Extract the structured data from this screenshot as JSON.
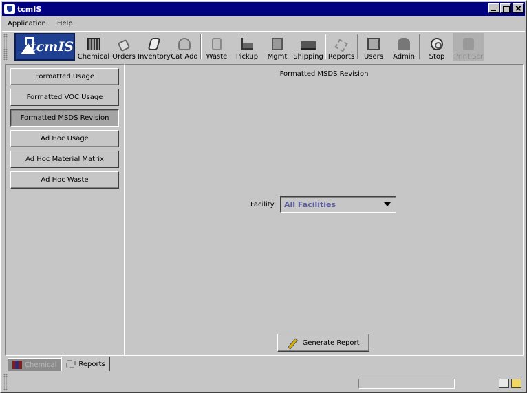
{
  "window": {
    "title": "tcmIS"
  },
  "menu": [
    "Application",
    "Help"
  ],
  "logo": {
    "text": "tcmIS"
  },
  "toolbar": [
    {
      "label": "Chemical",
      "icon": "chemical-icon"
    },
    {
      "label": "Orders",
      "icon": "orders-icon"
    },
    {
      "label": "Inventory",
      "icon": "inventory-icon"
    },
    {
      "label": "Cat Add",
      "icon": "cat-add-icon"
    },
    {
      "label": "Waste",
      "icon": "waste-icon"
    },
    {
      "label": "Pickup",
      "icon": "pickup-icon"
    },
    {
      "label": "Mgmt",
      "icon": "mgmt-icon"
    },
    {
      "label": "Shipping",
      "icon": "shipping-icon"
    },
    {
      "label": "Reports",
      "icon": "reports-icon"
    },
    {
      "label": "Users",
      "icon": "users-icon"
    },
    {
      "label": "Admin",
      "icon": "admin-icon"
    },
    {
      "label": "Stop",
      "icon": "stop-icon"
    },
    {
      "label": "Print Scr",
      "icon": "print-icon",
      "disabled": true
    }
  ],
  "reports": [
    {
      "label": "Formatted Usage"
    },
    {
      "label": "Formatted VOC Usage"
    },
    {
      "label": "Formatted MSDS Revision",
      "active": true
    },
    {
      "label": "Ad Hoc Usage"
    },
    {
      "label": "Ad Hoc Material Matrix"
    },
    {
      "label": "Ad Hoc Waste"
    }
  ],
  "main": {
    "title": "Formatted MSDS Revision",
    "facility_label": "Facility:",
    "facility_value": "All Facilities",
    "generate_label": "Generate Report"
  },
  "tabs": [
    {
      "label": "Chemical",
      "active": false
    },
    {
      "label": "Reports",
      "active": true
    }
  ],
  "colors": {
    "titlebar": "#000080",
    "face": "#c6c6c6",
    "logo": "#1f3f91",
    "select_text": "#5c5c9c"
  }
}
